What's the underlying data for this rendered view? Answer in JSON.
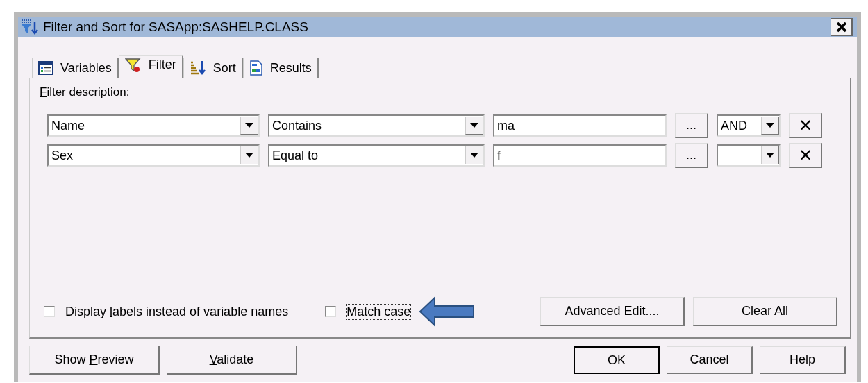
{
  "window": {
    "title": "Filter and Sort for SASApp:SASHELP.CLASS"
  },
  "tabs": [
    {
      "label": "Variables",
      "kind": "list",
      "selected": false
    },
    {
      "label": "Filter",
      "kind": "funnel",
      "selected": true
    },
    {
      "label": "Sort",
      "kind": "sort",
      "selected": false
    },
    {
      "label": "Results",
      "kind": "document",
      "selected": false
    }
  ],
  "filter_description": {
    "parts": [
      {
        "text": "F",
        "underlined": true
      },
      {
        "text": "ilter description:",
        "underlined": false
      }
    ]
  },
  "conditions": [
    {
      "variable": "Name",
      "operator": "Contains",
      "value": "ma",
      "conjunction": "AND"
    },
    {
      "variable": "Sex",
      "operator": "Equal to",
      "value": "f"
    }
  ],
  "ellipsis_label": "...",
  "remove_label": "✕",
  "options": [
    {
      "parts": [
        {
          "text": "Display ",
          "underlined": false
        },
        {
          "text": "l",
          "underlined": true
        },
        {
          "text": "abels instead of variable names",
          "underlined": false
        }
      ],
      "checked": false,
      "focused": false
    },
    {
      "parts": [
        {
          "text": "Match case",
          "underlined": false
        }
      ],
      "checked": false,
      "focused": true
    }
  ],
  "panel_buttons": [
    {
      "parts": [
        {
          "text": "A",
          "underlined": true
        },
        {
          "text": "dvanced Edit....",
          "underlined": false
        }
      ]
    },
    {
      "parts": [
        {
          "text": "C",
          "underlined": true
        },
        {
          "text": "lear All",
          "underlined": false
        }
      ]
    }
  ],
  "left_buttons": [
    {
      "parts": [
        {
          "text": "Show ",
          "underlined": false
        },
        {
          "text": "P",
          "underlined": true
        },
        {
          "text": "review",
          "underlined": false
        }
      ]
    },
    {
      "parts": [
        {
          "text": "V",
          "underlined": true
        },
        {
          "text": "alidate",
          "underlined": false
        }
      ]
    }
  ],
  "right_buttons": [
    {
      "parts": [
        {
          "text": "OK",
          "underlined": false
        }
      ],
      "default": true
    },
    {
      "parts": [
        {
          "text": "Cancel",
          "underlined": false
        }
      ],
      "default": false
    },
    {
      "parts": [
        {
          "text": "Help",
          "underlined": false
        }
      ],
      "default": false
    }
  ]
}
